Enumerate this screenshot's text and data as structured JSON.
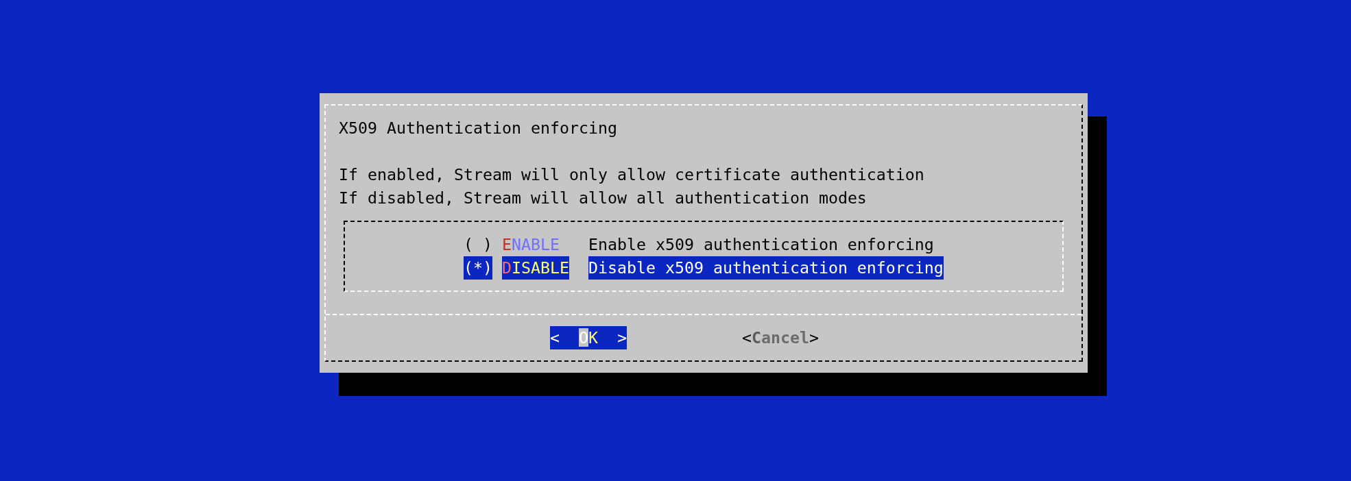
{
  "dialog": {
    "title": "X509 Authentication enforcing",
    "message": [
      "If enabled, Stream will only allow certificate authentication",
      "If disabled, Stream will allow all authentication modes"
    ],
    "options": [
      {
        "marker": "( )",
        "tag": "ENABLE",
        "description": "Enable x509 authentication enforcing",
        "selected": false
      },
      {
        "marker": "(*)",
        "tag": "DISABLE",
        "description": "Disable x509 authentication enforcing",
        "selected": true
      }
    ],
    "buttons": [
      {
        "kind": "wide",
        "parts": [
          {
            "text": "<",
            "kind": "bracket"
          },
          {
            "text": "O",
            "kind": "hotkey"
          },
          {
            "text": "K",
            "kind": "label"
          },
          {
            "text": ">",
            "kind": "bracket"
          }
        ],
        "selected": true
      },
      {
        "kind": "narrow",
        "parts": [
          {
            "text": "<",
            "kind": "bracket"
          },
          {
            "text": "C",
            "kind": "hotkey"
          },
          {
            "text": "ancel",
            "kind": "label"
          },
          {
            "text": ">",
            "kind": "bracket"
          }
        ],
        "selected": false
      }
    ]
  }
}
